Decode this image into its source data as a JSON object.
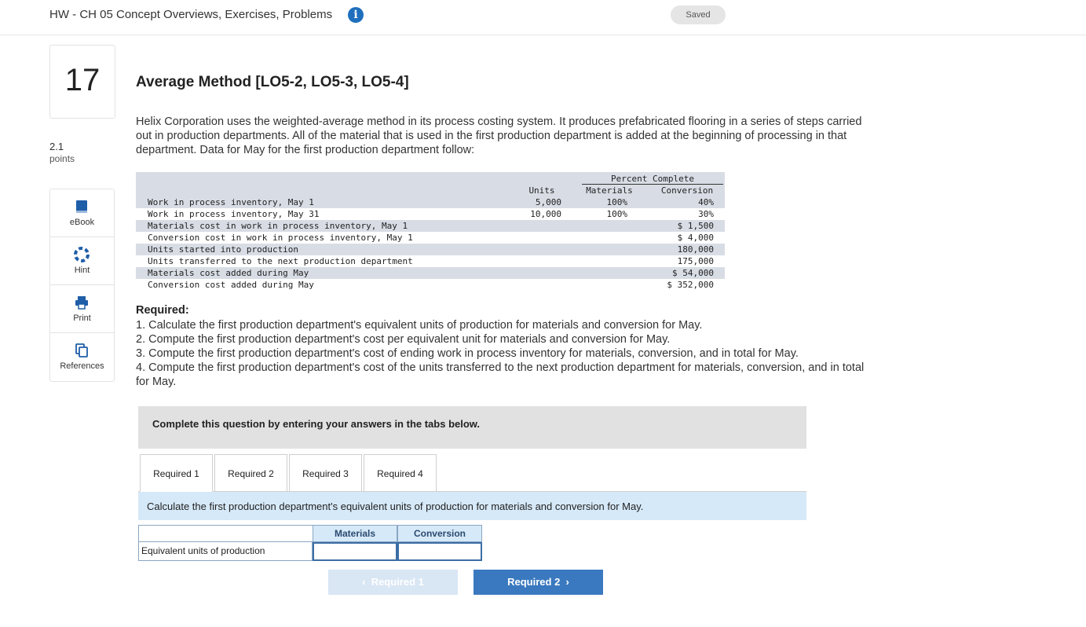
{
  "header": {
    "title": "HW - CH 05 Concept Overviews, Exercises, Problems",
    "info_icon": "i",
    "saved_label": "Saved"
  },
  "question": {
    "number": "17",
    "points_value": "2.1",
    "points_label": "points",
    "title": "Average Method [LO5-2, LO5-3, LO5-4]",
    "intro": "Helix Corporation uses the weighted-average method in its process costing system. It produces prefabricated flooring in a series of steps carried out in production departments. All of the material that is used in the first production department is added at the beginning of processing in that department. Data for May for the first production department follow:"
  },
  "tools": [
    {
      "label": "eBook",
      "icon": "book-icon"
    },
    {
      "label": "Hint",
      "icon": "lifebuoy-icon"
    },
    {
      "label": "Print",
      "icon": "printer-icon"
    },
    {
      "label": "References",
      "icon": "copy-icon"
    }
  ],
  "data_table": {
    "percent_complete_header": "Percent Complete",
    "col_units": "Units",
    "col_materials": "Materials",
    "col_conversion": "Conversion",
    "rows": [
      {
        "label": "Work in process inventory, May 1",
        "units": "5,000",
        "materials": "100%",
        "conversion": "40%"
      },
      {
        "label": "Work in process inventory, May 31",
        "units": "10,000",
        "materials": "100%",
        "conversion": "30%"
      },
      {
        "label": "Materials cost in work in process inventory, May 1",
        "units": "",
        "materials": "",
        "conversion": "$ 1,500"
      },
      {
        "label": "Conversion cost in work in process inventory, May 1",
        "units": "",
        "materials": "",
        "conversion": "$ 4,000"
      },
      {
        "label": "Units started into production",
        "units": "",
        "materials": "",
        "conversion": "180,000"
      },
      {
        "label": "Units transferred to the next production department",
        "units": "",
        "materials": "",
        "conversion": "175,000"
      },
      {
        "label": "Materials cost added during May",
        "units": "",
        "materials": "",
        "conversion": "$ 54,000"
      },
      {
        "label": "Conversion cost added during May",
        "units": "",
        "materials": "",
        "conversion": "$ 352,000"
      }
    ]
  },
  "required": {
    "heading": "Required:",
    "items": [
      "1. Calculate the first production department's equivalent units of production for materials and conversion for May.",
      "2. Compute the first production department's cost per equivalent unit for materials and conversion for May.",
      "3. Compute the first production department's cost of ending work in process inventory for materials, conversion, and in total for May.",
      "4. Compute the first production department's cost of the units transferred to the next production department for materials, conversion, and in total for May."
    ]
  },
  "answer_area": {
    "complete_prompt": "Complete this question by entering your answers in the tabs below.",
    "tabs": [
      "Required 1",
      "Required 2",
      "Required 3",
      "Required 4"
    ],
    "active_tab": "Required 1",
    "instruction": "Calculate the first production department's equivalent units of production for materials and conversion for May.",
    "col_materials": "Materials",
    "col_conversion": "Conversion",
    "row_label": "Equivalent units of production",
    "materials_value": "",
    "conversion_value": ""
  },
  "nav": {
    "prev_label": "Required 1",
    "next_label": "Required 2"
  },
  "colors": {
    "accent": "#3a79bf",
    "info": "#1f6fbd",
    "instruction_bg": "#d6e9f8",
    "table_bg": "#d8dde5"
  }
}
